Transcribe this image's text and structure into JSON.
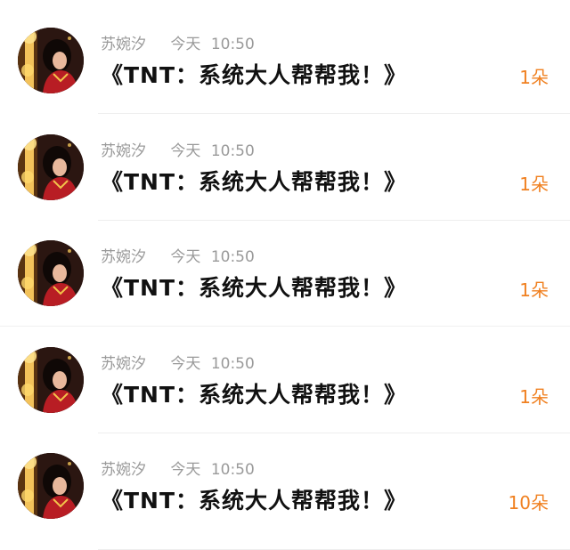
{
  "colors": {
    "meta": "#9a9a9a",
    "title": "#111111",
    "count": "#f08020",
    "separator": "#eeeeee"
  },
  "items": [
    {
      "author": "苏婉汐",
      "day": "今天",
      "time": "10:50",
      "title": "《TNT：系统大人帮帮我！》",
      "count": "1朵",
      "avatar_icon": "avatar-portrait-icon"
    },
    {
      "author": "苏婉汐",
      "day": "今天",
      "time": "10:50",
      "title": "《TNT：系统大人帮帮我！》",
      "count": "1朵",
      "avatar_icon": "avatar-portrait-icon"
    },
    {
      "author": "苏婉汐",
      "day": "今天",
      "time": "10:50",
      "title": "《TNT：系统大人帮帮我！》",
      "count": "1朵",
      "avatar_icon": "avatar-portrait-icon"
    },
    {
      "author": "苏婉汐",
      "day": "今天",
      "time": "10:50",
      "title": "《TNT：系统大人帮帮我！》",
      "count": "1朵",
      "avatar_icon": "avatar-portrait-icon"
    },
    {
      "author": "苏婉汐",
      "day": "今天",
      "time": "10:50",
      "title": "《TNT：系统大人帮帮我！》",
      "count": "10朵",
      "avatar_icon": "avatar-portrait-icon"
    }
  ]
}
